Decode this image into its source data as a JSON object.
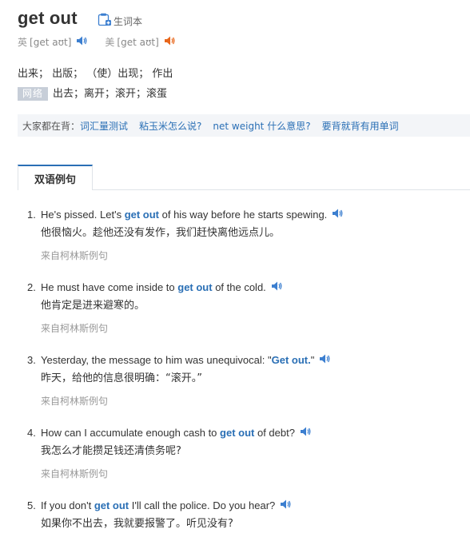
{
  "entry": {
    "word": "get out",
    "wordbook_label": "生词本"
  },
  "pronunciations": {
    "uk_label": "英",
    "uk_phonetic": "[get aʊt]",
    "us_label": "美",
    "us_phonetic": "[get aʊt]"
  },
  "translations": {
    "basic": "出来； 出版； （使）出现； 作出",
    "web_tag": "网络",
    "web": "出去；离开；滚开；滚蛋"
  },
  "hot_searches": {
    "prefix": "大家都在背：",
    "links": [
      "词汇量测试",
      "粘玉米怎么说?",
      "net weight 什么意思?",
      "要背就背有用单词"
    ]
  },
  "tabs": [
    {
      "label": "双语例句",
      "active": true
    }
  ],
  "examples": [
    {
      "num": "1.",
      "before": "He's pissed. Let's ",
      "kw": "get out",
      "after": " of his way before he starts spewing.",
      "zh": "他很恼火。趁他还没有发作，我们赶快离他远点儿。",
      "source": "来自柯林斯例句"
    },
    {
      "num": "2.",
      "before": "He must have come inside to ",
      "kw": "get out",
      "after": " of the cold.",
      "zh": "他肯定是进来避寒的。",
      "source": "来自柯林斯例句"
    },
    {
      "num": "3.",
      "before": "Yesterday, the message to him was unequivocal: \"",
      "kw": "Get out.",
      "after": "\"",
      "zh": "昨天，给他的信息很明确：“滚开。”",
      "source": "来自柯林斯例句"
    },
    {
      "num": "4.",
      "before": "How can I accumulate enough cash to ",
      "kw": "get out",
      "after": " of debt?",
      "zh": "我怎么才能攒足钱还清债务呢?",
      "source": "来自柯林斯例句"
    },
    {
      "num": "5.",
      "before": "If you don't ",
      "kw": "get out",
      "after": " I'll call the police. Do you hear?",
      "zh": "如果你不出去，我就要报警了。听见没有?",
      "source": ""
    }
  ],
  "colors": {
    "accent": "#2a6fb5",
    "speaker_uk": "#3c7fd0",
    "speaker_us": "#e8671c"
  }
}
